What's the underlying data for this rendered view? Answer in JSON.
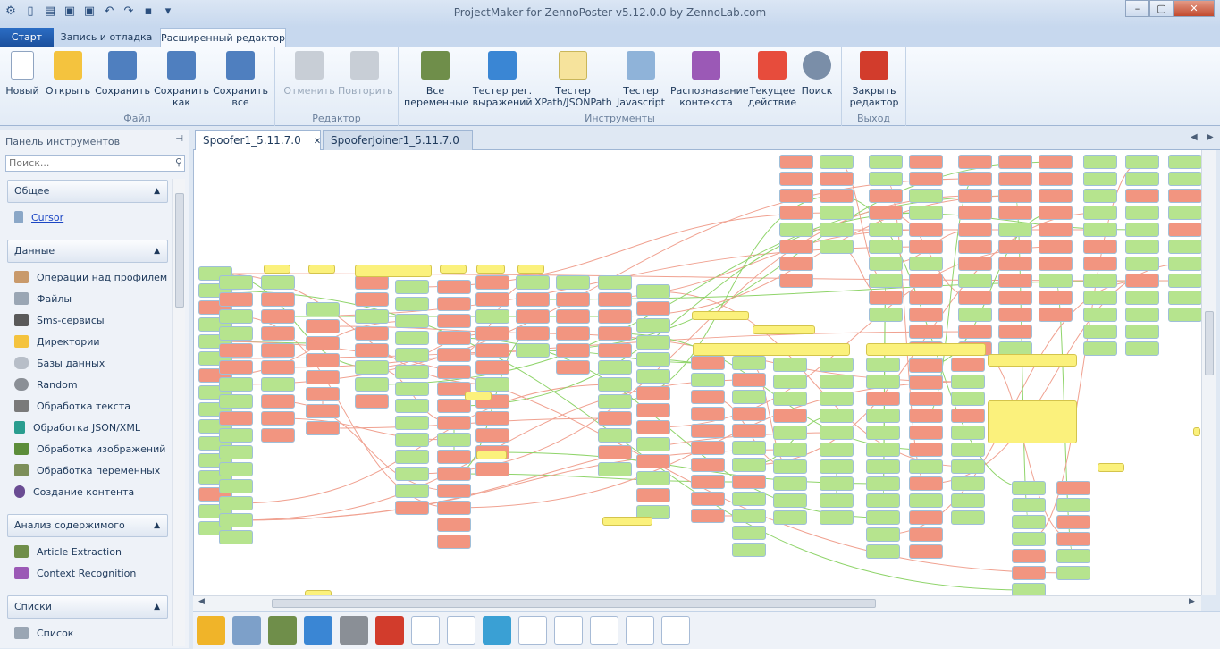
{
  "window": {
    "title": "ProjectMaker for ZennoPoster v5.12.0.0 by ZennoLab.com",
    "controls": [
      "–",
      "▢",
      "✕"
    ]
  },
  "quick_access": [
    "app-menu-icon",
    "new-icon",
    "open-icon",
    "save-icon",
    "save-all-icon",
    "undo-icon",
    "redo-icon",
    "view-icon",
    "customize-icon"
  ],
  "ribbon_tabs": [
    "Старт",
    "Запись и отладка",
    "Расширенный редактор"
  ],
  "ribbon_groups": {
    "file": {
      "label": "Файл",
      "buttons": [
        {
          "label": "Новый",
          "icon": "new-file-icon",
          "color": "#ffffff"
        },
        {
          "label": "Открыть",
          "icon": "folder-open-icon",
          "color": "#f4c33e"
        },
        {
          "label": "Сохранить",
          "icon": "floppy-icon",
          "color": "#4f7fbf"
        },
        {
          "label": "Сохранить как",
          "icon": "floppy-as-icon",
          "color": "#4f7fbf"
        },
        {
          "label": "Сохранить все",
          "icon": "floppy-all-icon",
          "color": "#4f7fbf"
        }
      ]
    },
    "editor": {
      "label": "Редактор",
      "buttons": [
        {
          "label": "Отменить",
          "icon": "undo-arrow-icon",
          "color": "#c8ced6"
        },
        {
          "label": "Повторить",
          "icon": "redo-arrow-icon",
          "color": "#c8ced6"
        }
      ]
    },
    "tools": {
      "label": "Инструменты",
      "buttons": [
        {
          "label": "Все переменные",
          "icon": "variables-board-icon",
          "color": "#6f8e4a"
        },
        {
          "label": "Тестер рег. выражений",
          "icon": "regex-book-icon",
          "color": "#3a86d4"
        },
        {
          "label": "Тестер XPath/JSONPath",
          "icon": "xpath-grid-icon",
          "color": "#f6e39c"
        },
        {
          "label": "Тестер Javascript",
          "icon": "javascript-scroll-icon",
          "color": "#8fb3d9"
        },
        {
          "label": "Распознавание контекста",
          "icon": "context-wand-icon",
          "color": "#9b59b6"
        },
        {
          "label": "Текущее действие",
          "icon": "current-action-icon",
          "color": "#e74c3c"
        },
        {
          "label": "Поиск",
          "icon": "magnifier-icon",
          "color": "#7a8ea8"
        }
      ]
    },
    "exit": {
      "label": "Выход",
      "buttons": [
        {
          "label": "Закрыть редактор",
          "icon": "close-red-icon",
          "color": "#d23c2c"
        }
      ]
    }
  },
  "toolbox": {
    "title": "Панель инструментов",
    "pin": "⊣",
    "search_placeholder": "Поиск...",
    "categories": [
      {
        "label": "Общее",
        "items": [
          {
            "label": "Cursor",
            "icon": "cursor-icon",
            "color": "#8aa7c7"
          }
        ]
      },
      {
        "label": "Данные",
        "items": [
          {
            "label": "Операции над профилем",
            "icon": "profile-icon",
            "color": "#c99a6b"
          },
          {
            "label": "Файлы",
            "icon": "files-icon",
            "color": "#9aa6b4"
          },
          {
            "label": "Sms-сервисы",
            "icon": "sms-icon",
            "color": "#5a5a5a"
          },
          {
            "label": "Директории",
            "icon": "folder-icon",
            "color": "#f4c33e"
          },
          {
            "label": "Базы данных",
            "icon": "database-icon",
            "color": "#b7bec8"
          },
          {
            "label": "Random",
            "icon": "dice-icon",
            "color": "#8a8f96"
          },
          {
            "label": "Обработка текста",
            "icon": "pen-icon",
            "color": "#7a7a7a"
          },
          {
            "label": "Обработка JSON/XML",
            "icon": "json-icon",
            "color": "#2a9d8f"
          },
          {
            "label": "Обработка изображений",
            "icon": "image-icon",
            "color": "#5c8d3a"
          },
          {
            "label": "Обработка переменных",
            "icon": "variables-icon",
            "color": "#7d8f5a"
          },
          {
            "label": "Создание контента",
            "icon": "content-icon",
            "color": "#6a4c93"
          }
        ]
      },
      {
        "label": "Анализ содержимого",
        "items": [
          {
            "label": "Article Extraction",
            "icon": "article-icon",
            "color": "#6f8e4a"
          },
          {
            "label": "Context Recognition",
            "icon": "context-icon",
            "color": "#9b59b6"
          }
        ]
      },
      {
        "label": "Списки",
        "items": [
          {
            "label": "Список",
            "icon": "list-icon",
            "color": "#9aa6b4"
          }
        ]
      }
    ]
  },
  "doc_tabs": [
    {
      "label": "Spoofer1_5.11.7.0",
      "close": "✕"
    },
    {
      "label": "SpooferJoiner1_5.11.7.0"
    }
  ],
  "bottom_icons": [
    "gears-icon",
    "user-icon",
    "board-icon",
    "robot-icon",
    "lock-icon",
    "code-doc-icon",
    "list-doc-icon",
    "list-doc-icon",
    "tree-icon",
    "list-doc-icon",
    "list-doc-icon",
    "list-doc-icon",
    "list-doc-icon",
    "list-doc-icon"
  ],
  "colors": {
    "accent": "#1b4f9b",
    "node_green": "#b6e48e",
    "node_red": "#f29580",
    "node_yellow": "#fbf17c",
    "link_red": "#f0a190",
    "link_green": "#8fd46a"
  }
}
